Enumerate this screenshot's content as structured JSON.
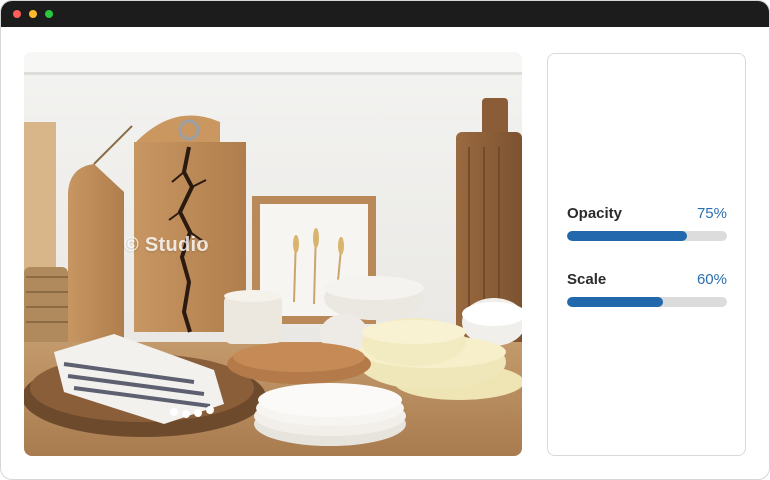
{
  "window": {
    "controls": [
      "close",
      "minimize",
      "maximize"
    ]
  },
  "image": {
    "watermark": "© Studio",
    "subject": "wooden cutting boards, framed dried wheat, ceramic bowls and plates on a wooden shelf"
  },
  "controls": [
    {
      "label": "Opacity",
      "value_text": "75%",
      "value": 0.75
    },
    {
      "label": "Scale",
      "value_text": "60%",
      "value": 0.6
    }
  ],
  "colors": {
    "accent": "#2268ad",
    "value_text": "#2a6fb0",
    "track": "#dcdcdc",
    "titlebar": "#1c1c1c"
  }
}
